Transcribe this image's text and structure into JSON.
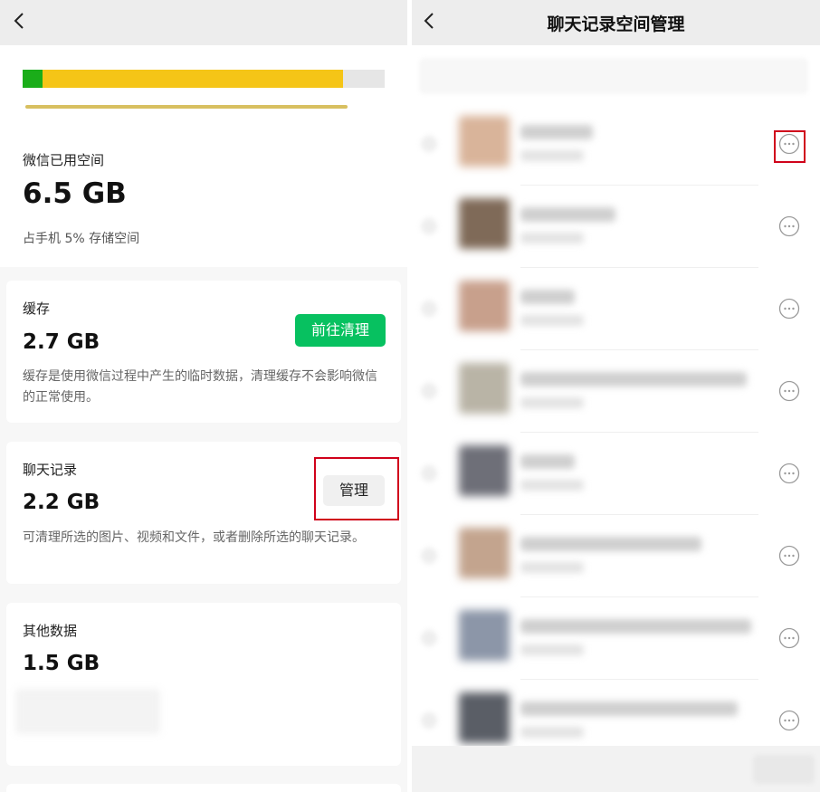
{
  "left": {
    "storage_bar": {
      "green_fraction": 0.055,
      "yellow_fraction": 0.83
    },
    "used_label": "微信已用空间",
    "used_value": "6.5 GB",
    "used_sub": "占手机 5% 存储空间",
    "cards": {
      "cache": {
        "title": "缓存",
        "value": "2.7 GB",
        "button": "前往清理",
        "desc": "缓存是使用微信过程中产生的临时数据，清理缓存不会影响微信的正常使用。"
      },
      "chat": {
        "title": "聊天记录",
        "value": "2.2 GB",
        "button": "管理",
        "desc": "可清理所选的图片、视频和文件，或者删除所选的聊天记录。"
      },
      "other": {
        "title": "其他数据",
        "value": "1.5 GB"
      }
    }
  },
  "right": {
    "title": "聊天记录空间管理",
    "rows": [
      {
        "avatar_color": "#d9b49a",
        "name_width": 80
      },
      {
        "avatar_color": "#7f6a58",
        "name_width": 105
      },
      {
        "avatar_color": "#c8a08c",
        "name_width": 60
      },
      {
        "avatar_color": "#b9b4a6",
        "name_width": 250
      },
      {
        "avatar_color": "#6e6f78",
        "name_width": 60
      },
      {
        "avatar_color": "#c3a48e",
        "name_width": 200
      },
      {
        "avatar_color": "#8c96a8",
        "name_width": 255
      },
      {
        "avatar_color": "#5a5e66",
        "name_width": 240
      }
    ]
  },
  "colors": {
    "accent_green": "#07c160",
    "highlight_red": "#d0021b",
    "bar_yellow": "#f5c517"
  },
  "icons": {
    "back": "chevron-left-icon",
    "more": "more-options-icon"
  }
}
